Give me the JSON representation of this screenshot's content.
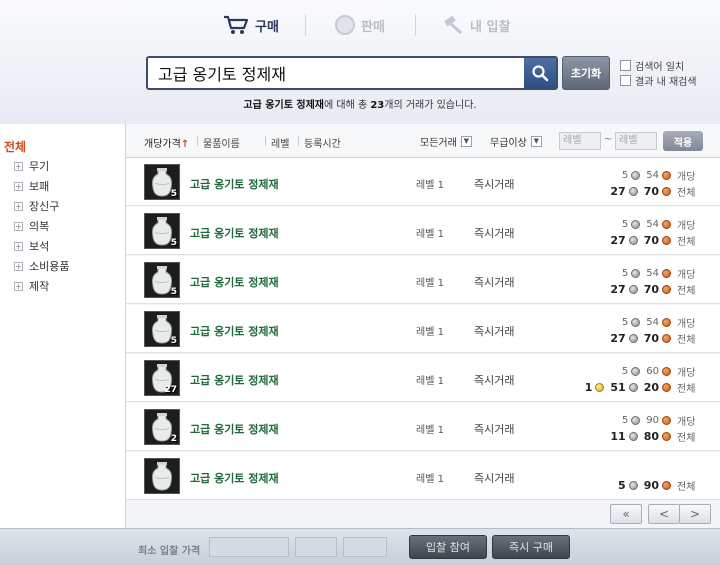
{
  "tabs": {
    "buy": "구매",
    "sell": "판매",
    "my_bids": "내 입찰"
  },
  "search": {
    "value": "고급 옹기토 정제재",
    "reset_label": "초기화"
  },
  "options": {
    "exact_match": "검색어 일치",
    "search_within": "결과 내 재검색"
  },
  "result": {
    "keyword": "고급 옹기토 정제재",
    "middle": "에 대해 총 ",
    "count": "23",
    "suffix": "개의 거래가 있습니다."
  },
  "categories": {
    "all": "전체",
    "items": [
      "무기",
      "보패",
      "장신구",
      "의복",
      "보석",
      "소비용품",
      "제작"
    ]
  },
  "sort": {
    "unit_price": "개당가격",
    "name": "물품이름",
    "level": "레벨",
    "time": "등록시간",
    "trade_filter": "모든거래",
    "grade_filter": "무급이상",
    "level_min_placeholder": "레벨",
    "level_max_placeholder": "레벨",
    "apply": "적용"
  },
  "listings": [
    {
      "name": "고급 옹기토 정제재",
      "stack": "5",
      "level": "레벨 1",
      "type": "즉시거래",
      "unit_gold": "",
      "unit_silver": "5",
      "unit_copper": "54",
      "unit_label": "개당",
      "total_gold": "",
      "total_silver": "27",
      "total_copper": "70",
      "total_label": "전체"
    },
    {
      "name": "고급 옹기토 정제재",
      "stack": "5",
      "level": "레벨 1",
      "type": "즉시거래",
      "unit_gold": "",
      "unit_silver": "5",
      "unit_copper": "54",
      "unit_label": "개당",
      "total_gold": "",
      "total_silver": "27",
      "total_copper": "70",
      "total_label": "전체"
    },
    {
      "name": "고급 옹기토 정제재",
      "stack": "5",
      "level": "레벨 1",
      "type": "즉시거래",
      "unit_gold": "",
      "unit_silver": "5",
      "unit_copper": "54",
      "unit_label": "개당",
      "total_gold": "",
      "total_silver": "27",
      "total_copper": "70",
      "total_label": "전체"
    },
    {
      "name": "고급 옹기토 정제재",
      "stack": "5",
      "level": "레벨 1",
      "type": "즉시거래",
      "unit_gold": "",
      "unit_silver": "5",
      "unit_copper": "54",
      "unit_label": "개당",
      "total_gold": "",
      "total_silver": "27",
      "total_copper": "70",
      "total_label": "전체"
    },
    {
      "name": "고급 옹기토 정제재",
      "stack": "27",
      "level": "레벨 1",
      "type": "즉시거래",
      "unit_gold": "",
      "unit_silver": "5",
      "unit_copper": "60",
      "unit_label": "개당",
      "total_gold": "1",
      "total_silver": "51",
      "total_copper": "20",
      "total_label": "전체"
    },
    {
      "name": "고급 옹기토 정제재",
      "stack": "2",
      "level": "레벨 1",
      "type": "즉시거래",
      "unit_gold": "",
      "unit_silver": "5",
      "unit_copper": "90",
      "unit_label": "개당",
      "total_gold": "",
      "total_silver": "11",
      "total_copper": "80",
      "total_label": "전체"
    },
    {
      "name": "고급 옹기토 정제재",
      "stack": "",
      "level": "레벨 1",
      "type": "즉시거래",
      "unit_gold": "",
      "unit_silver": "",
      "unit_copper": "",
      "unit_label": "",
      "total_gold": "",
      "total_silver": "5",
      "total_copper": "90",
      "total_label": "전체"
    }
  ],
  "pager": {
    "first": "«",
    "prev": "<",
    "next": ">"
  },
  "bottom": {
    "min_bid_label": "최소 입찰 가격",
    "bid_button": "입찰 참여",
    "buy_button": "즉시 구매"
  },
  "colors": {
    "item_name": "#1f6a3a",
    "category_active": "#d24a1c",
    "search_border": "#3e4d69"
  }
}
